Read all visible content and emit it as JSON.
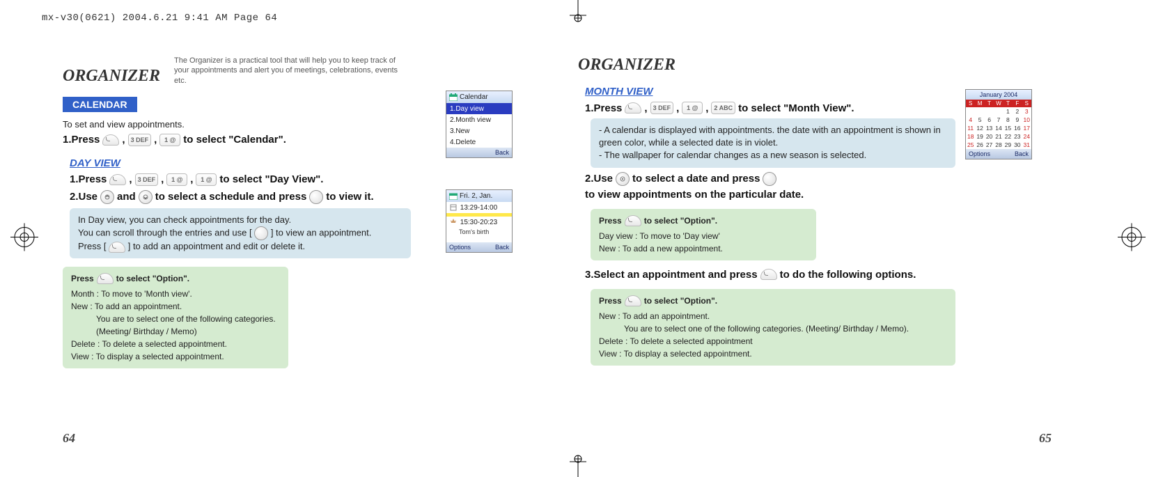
{
  "header_line": "mx-v30(0621)  2004.6.21  9:41 AM  Page 64",
  "left": {
    "title": "ORGANIZER",
    "subtitle": "The Organizer is a practical tool that will help you to keep track of your appointments and alert you of meetings, celebrations, events etc.",
    "section_badge": "CALENDAR",
    "intro": "To set and view appointments.",
    "step1_a": "1.Press",
    "step1_b": "to select \"Calendar\".",
    "dayview_heading": "DAY VIEW",
    "dv_step1_a": "1.Press",
    "dv_step1_b": "to select \"Day View\".",
    "dv_step2_a": "2.Use",
    "dv_step2_b": "and",
    "dv_step2_c": "to select a schedule and press",
    "dv_step2_d": "to view it.",
    "dv_info1_l1": "In Day view, you can check appointments for the day.",
    "dv_info1_l2a": "You can scroll through the entries and use [",
    "dv_info1_l2b": "] to view an appointment.",
    "dv_info1_l3a": "Press [",
    "dv_info1_l3b": "] to add an appointment and edit or delete it.",
    "opt_hdr_a": "Press",
    "opt_hdr_b": "to select \"Option\".",
    "opt_month": "Month : To move to 'Month view'.",
    "opt_new": "New : To add an appointment.",
    "opt_new_sub1": "You are to select one of the following categories.",
    "opt_new_sub2": "(Meeting/ Birthday / Memo)",
    "opt_delete": "Delete : To delete a selected appointment.",
    "opt_view": "View : To display a selected appointment.",
    "page_number": "64",
    "keys": {
      "k3": "3 DEF",
      "k1a": "1 @",
      "k1b": "1 @"
    },
    "screen1": {
      "title": "Calendar",
      "items": [
        "1.Day view",
        "2.Month view",
        "3.New",
        "4.Delete"
      ],
      "foot_right": "Back"
    },
    "screen2": {
      "title": "Fri. 2, Jan.",
      "row1": "13:29-14:00",
      "row2": "15:30-20:23",
      "row2_sub": "Tom's birth",
      "foot_left": "Options",
      "foot_right": "Back"
    }
  },
  "right": {
    "title": "ORGANIZER",
    "monthview_heading": "MONTH VIEW",
    "mv_step1_a": "1.Press",
    "mv_step1_b": "to select \"Month View\".",
    "keys": {
      "k3": "3 DEF",
      "k1": "1 @",
      "k2": "2 ABC"
    },
    "mv_info_l1": "- A calendar is displayed with appointments. the date with an appointment is shown in green color, while a selected date is in violet.",
    "mv_info_l2": "- The wallpaper for calendar changes as a new season is selected.",
    "mv_step2_a": "2.Use",
    "mv_step2_b": "to select a date and press",
    "mv_step2_c": "to view appointments on the particular date.",
    "opt_hdr_a": "Press",
    "opt_hdr_b": "to select \"Option\".",
    "opt_day": "Day view : To move to 'Day view'",
    "opt_new": "New : To add a new appointment.",
    "mv_step3_a": "3.Select an appointment and press",
    "mv_step3_b": "to do the following options.",
    "opt2_hdr_a": "Press",
    "opt2_hdr_b": "to select \"Option\".",
    "opt2_new": "New : To add an appointment.",
    "opt2_new_sub": "You are to select one of the following categories. (Meeting/ Birthday / Memo).",
    "opt2_delete": "Delete : To delete a selected appointment",
    "opt2_view": "View : To display a selected appointment.",
    "page_number": "65",
    "calendar": {
      "title": "January 2004",
      "headers": [
        "S",
        "M",
        "T",
        "W",
        "T",
        "F",
        "S"
      ],
      "rows": [
        [
          "",
          "",
          "",
          "",
          "1",
          "2",
          "3"
        ],
        [
          "4",
          "5",
          "6",
          "7",
          "8",
          "9",
          "10"
        ],
        [
          "11",
          "12",
          "13",
          "14",
          "15",
          "16",
          "17"
        ],
        [
          "18",
          "19",
          "20",
          "21",
          "22",
          "23",
          "24"
        ],
        [
          "25",
          "26",
          "27",
          "28",
          "29",
          "30",
          "31"
        ]
      ],
      "foot_left": "Options",
      "foot_right": "Back"
    }
  }
}
